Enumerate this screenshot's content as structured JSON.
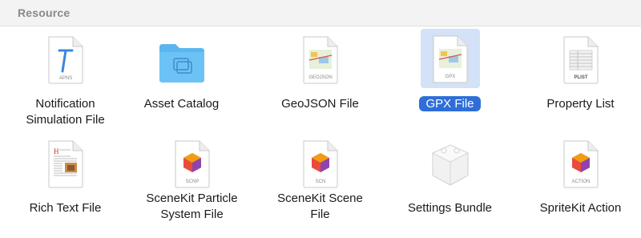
{
  "section": {
    "title": "Resource"
  },
  "colors": {
    "selection_bg": "#d3e2f6",
    "selection_label": "#2f6ed8",
    "folder": "#5bb6ef"
  },
  "templates": [
    {
      "label": "Notification\nSimulation File",
      "icon": "apns-file-icon",
      "badge": "APNS",
      "selected": false
    },
    {
      "label": "Asset Catalog",
      "icon": "folder-icon",
      "selected": false
    },
    {
      "label": "GeoJSON File",
      "icon": "geojson-file-icon",
      "badge": "GEOJSON",
      "selected": false
    },
    {
      "label": "GPX File",
      "icon": "gpx-file-icon",
      "badge": "GPX",
      "selected": true
    },
    {
      "label": "Property List",
      "icon": "plist-file-icon",
      "badge": "PLIST",
      "selected": false
    },
    {
      "label": "Rich Text File",
      "icon": "rich-text-file-icon",
      "selected": false
    },
    {
      "label": "SceneKit Particle\nSystem File",
      "icon": "scnp-file-icon",
      "badge": "SCNP",
      "selected": false
    },
    {
      "label": "SceneKit Scene\nFile",
      "icon": "scn-file-icon",
      "badge": "SCN",
      "selected": false
    },
    {
      "label": "Settings Bundle",
      "icon": "settings-bundle-icon",
      "selected": false
    },
    {
      "label": "SpriteKit Action",
      "icon": "spritekit-action-icon",
      "badge": "ACTION",
      "selected": false
    }
  ]
}
